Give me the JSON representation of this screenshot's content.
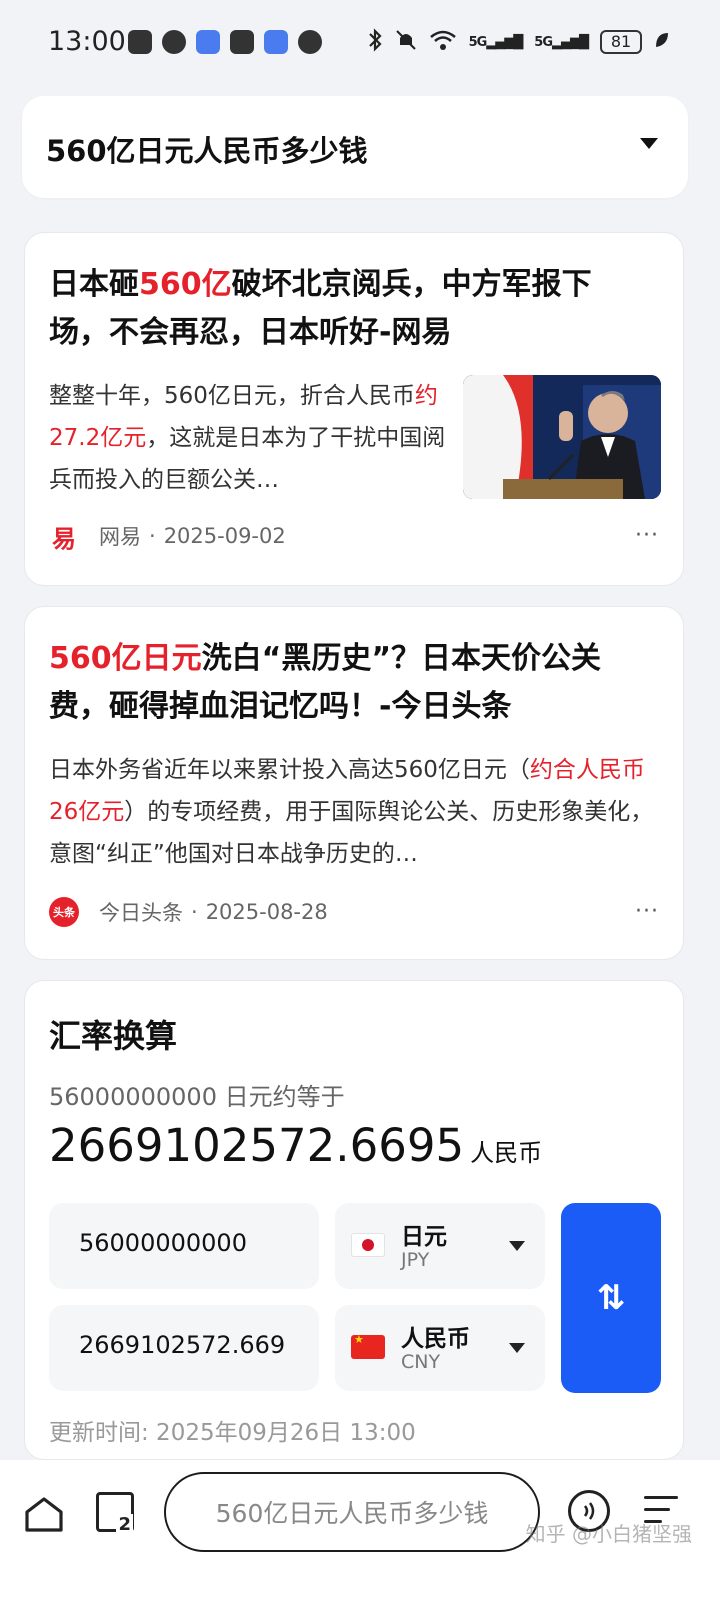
{
  "status_bar": {
    "time": "13:00",
    "battery": "81",
    "signal1": "5G",
    "signal2": "5G"
  },
  "query": {
    "text": "560亿日元人民币多少钱"
  },
  "results": [
    {
      "title_red": "",
      "title_parts": [
        "日本砸",
        "560亿",
        "破坏北京阅兵，中方军报下场，不会再忍，日本听好-网易"
      ],
      "snippet_parts": [
        "整整十年，560亿日元，折合人民币",
        "约27.2亿元",
        "，这就是日本为了干扰中国阅兵而投入的巨额公关…"
      ],
      "source": "网易",
      "date": "2025-09-02",
      "logo_char": "易"
    },
    {
      "title_parts": [
        "560亿日元",
        "洗白“黑历史”？日本天价公关费，砸得掉血泪记忆吗！-今日头条"
      ],
      "snippet_parts": [
        "日本外务省近年以来累计投入高达560亿日元（",
        "约合人民币26亿元",
        "）的专项经费，用于国际舆论公关、历史形象美化，意图“纠正”他国对日本战争历史的…"
      ],
      "source": "今日头条",
      "date": "2025-08-28",
      "logo_char": "头条"
    }
  ],
  "separator": "·",
  "more_glyph": "···",
  "converter": {
    "title": "汇率换算",
    "subtitle": "56000000000 日元约等于",
    "result_value": "2669102572.6695",
    "result_unit": "人民币",
    "from_value": "56000000000",
    "to_value": "2669102572.6695",
    "from_currency": {
      "name": "日元",
      "code": "JPY"
    },
    "to_currency": {
      "name": "人民币",
      "code": "CNY"
    },
    "swap_glyph": "⇅",
    "updated": "更新时间: 2025年09月26日 13:00"
  },
  "bottom_bar": {
    "tab_count": "2",
    "search_text": "560亿日元人民币多少钱",
    "watermark": "知乎 @小白猪坚强"
  }
}
